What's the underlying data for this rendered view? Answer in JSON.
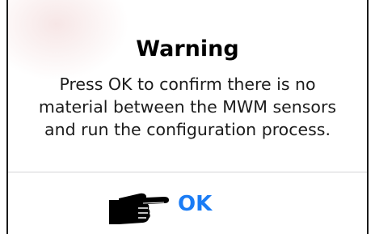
{
  "dialog": {
    "title": "Warning",
    "message_lines": [
      "Press OK to confirm there is no",
      "material between the MWM sensors",
      "and run the configuration process."
    ],
    "ok_label": "OK"
  },
  "icons": {
    "pointer": "pointing-hand-icon"
  },
  "colors": {
    "accent": "#1a7cf5",
    "title": "#000000",
    "divider": "#d5d5d8"
  }
}
